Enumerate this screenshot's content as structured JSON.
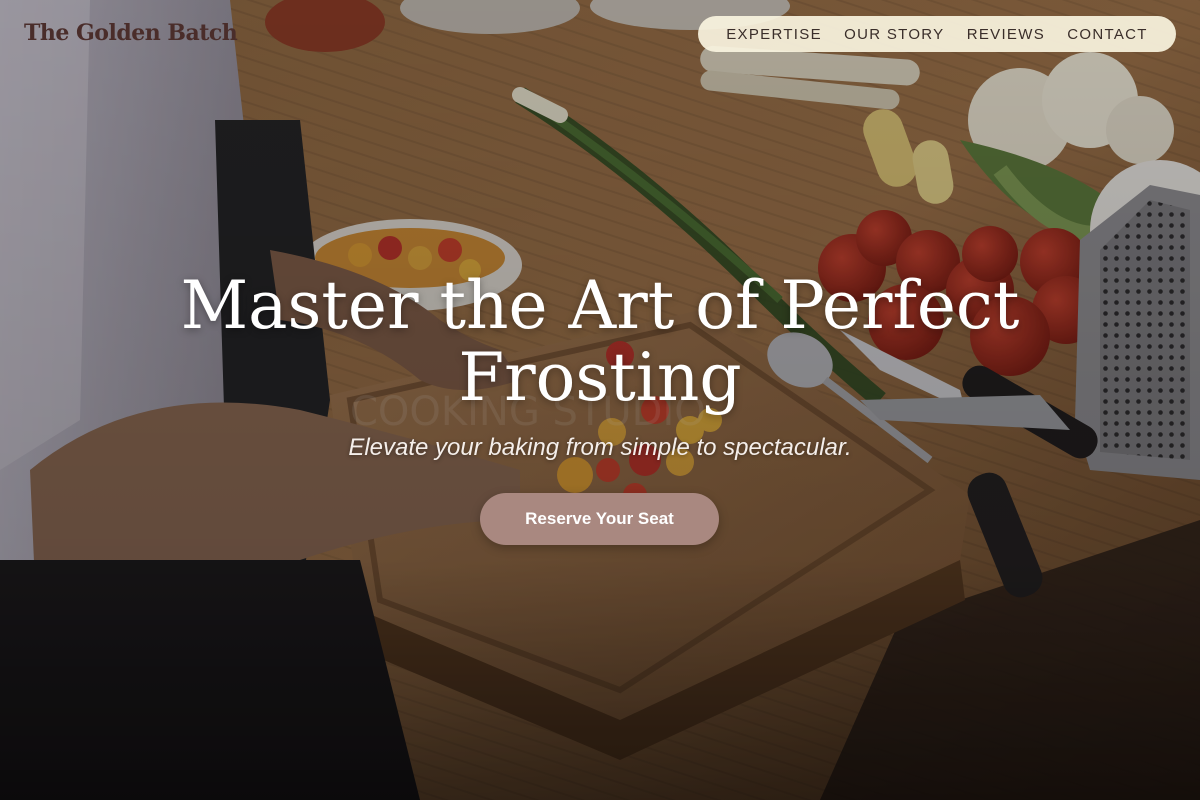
{
  "brand": {
    "name": "The Golden Batch"
  },
  "nav": {
    "items": [
      {
        "label": "EXPERTISE"
      },
      {
        "label": "OUR STORY"
      },
      {
        "label": "REVIEWS"
      },
      {
        "label": "CONTACT"
      }
    ]
  },
  "hero": {
    "headline": "Master the Art of Perfect Frosting",
    "tagline": "Elevate your baking from simple to spectacular.",
    "cta_label": "Reserve Your Seat",
    "background_image": "kitchen-prep-photo"
  },
  "colors": {
    "logo": "#4a2d2a",
    "nav_pill": "#faf4e0",
    "nav_text": "#3a2e2a",
    "cta": "#a98880",
    "headline": "#ffffff"
  }
}
